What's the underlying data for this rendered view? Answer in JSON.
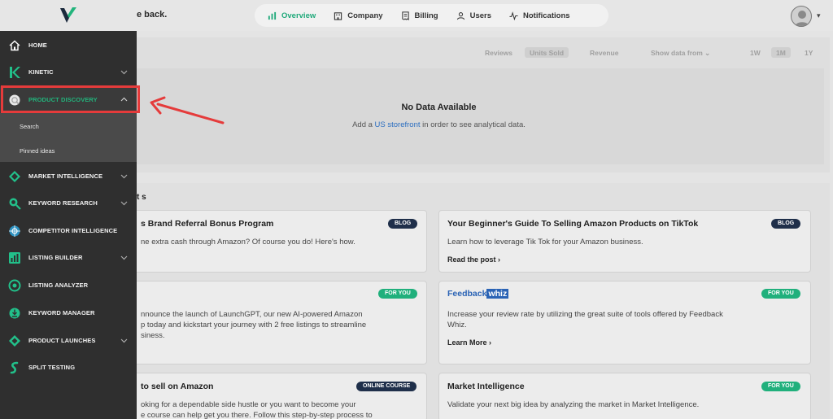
{
  "header": {
    "greeting": "e back.",
    "nav": [
      {
        "label": "Overview",
        "icon": "bar-chart-icon",
        "active": true
      },
      {
        "label": "Company",
        "icon": "building-icon",
        "active": false
      },
      {
        "label": "Billing",
        "icon": "receipt-icon",
        "active": false
      },
      {
        "label": "Users",
        "icon": "user-icon",
        "active": false
      },
      {
        "label": "Notifications",
        "icon": "pulse-icon",
        "active": false
      }
    ]
  },
  "analytics": {
    "tabs": [
      "Reviews",
      "Units Sold",
      "Revenue"
    ],
    "active_tab": "Units Sold",
    "show_data_from": "Show data from",
    "ranges": [
      "1W",
      "1M",
      "1Y"
    ],
    "active_range": "1M",
    "empty_title": "No Data Available",
    "empty_pre": "Add a",
    "empty_link": "US storefront",
    "empty_post": "in order to see analytical data."
  },
  "news": {
    "title": "t s",
    "cards": [
      {
        "title": "s Brand Referral Bonus Program",
        "desc": "ne extra cash through Amazon? Of course you do! Here's how.",
        "badge": "BLOG"
      },
      {
        "title": "Your Beginner's Guide To Selling Amazon Products on TikTok",
        "desc": "Learn how to leverage Tik Tok for your Amazon business.",
        "badge": "BLOG",
        "link": "Read the post"
      },
      {
        "desc1": "nnounce the launch of LaunchGPT, our new AI-powered Amazon",
        "desc2": "p today and kickstart your journey with 2 free listings to streamline",
        "desc3": "siness.",
        "badge": "FOR YOU"
      },
      {
        "logo_text": "Feedback",
        "logo_badge": "whiz",
        "desc1": "Increase your review rate by utilizing the great suite of tools offered by Feedback",
        "desc2": "Whiz.",
        "badge": "FOR YOU",
        "link": "Learn More"
      },
      {
        "title": "to sell on Amazon",
        "desc1": "oking for a dependable side hustle or you want to become your",
        "desc2": "e course can help get you there. Follow this step-by-step process to",
        "badge": "ONLINE COURSE"
      },
      {
        "title": "Market Intelligence",
        "desc": "Validate your next big idea by analyzing the market in Market Intelligence.",
        "badge": "FOR YOU"
      }
    ]
  },
  "sidebar": {
    "items": [
      {
        "label": "HOME",
        "icon": "home-icon",
        "caret": false
      },
      {
        "label": "KINETIC",
        "icon": "kinetic-icon",
        "caret": true
      },
      {
        "label": "PRODUCT DISCOVERY",
        "icon": "product-discovery-icon",
        "caret": true,
        "active": true
      },
      {
        "label": "MARKET INTELLIGENCE",
        "icon": "market-intelligence-icon",
        "caret": true
      },
      {
        "label": "KEYWORD RESEARCH",
        "icon": "keyword-research-icon",
        "caret": true
      },
      {
        "label": "COMPETITOR INTELLIGENCE",
        "icon": "competitor-icon",
        "caret": false
      },
      {
        "label": "LISTING BUILDER",
        "icon": "listing-builder-icon",
        "caret": true
      },
      {
        "label": "LISTING ANALYZER",
        "icon": "listing-analyzer-icon",
        "caret": false
      },
      {
        "label": "KEYWORD MANAGER",
        "icon": "keyword-manager-icon",
        "caret": false
      },
      {
        "label": "PRODUCT LAUNCHES",
        "icon": "product-launches-icon",
        "caret": true
      },
      {
        "label": "SPLIT TESTING",
        "icon": "split-testing-icon",
        "caret": false
      }
    ],
    "sub_items": [
      "Search",
      "Pinned ideas"
    ]
  },
  "colors": {
    "accent": "#1fa97a",
    "sidebar_bg": "#2f2f2f",
    "highlight": "#e53b3b",
    "badge_dark": "#1f2f4a"
  }
}
